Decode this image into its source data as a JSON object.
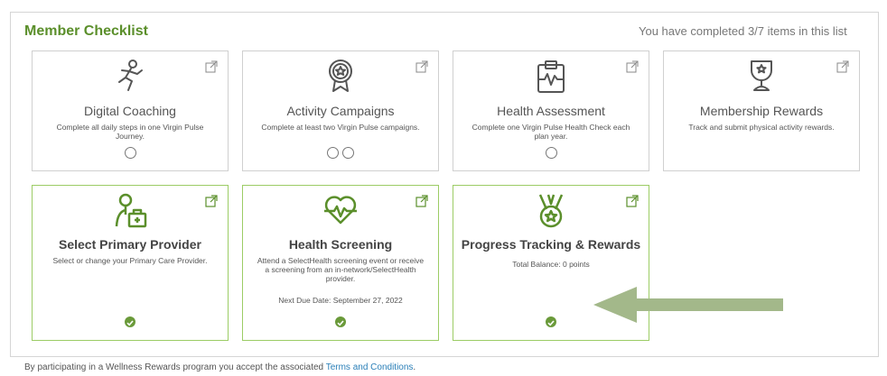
{
  "header": {
    "title": "Member Checklist",
    "status": "You have completed 3/7 items in this list"
  },
  "cards": [
    {
      "title": "Digital Coaching",
      "desc": "Complete all daily steps in one Virgin Pulse Journey.",
      "icon": "running-person-icon",
      "circles": 1
    },
    {
      "title": "Activity Campaigns",
      "desc": "Complete at least two Virgin Pulse campaigns.",
      "icon": "medal-icon",
      "circles": 2
    },
    {
      "title": "Health Assessment",
      "desc": "Complete one Virgin Pulse Health Check each plan year.",
      "icon": "clipboard-heartbeat-icon",
      "circles": 1
    },
    {
      "title": "Membership Rewards",
      "desc": "Track and submit physical activity rewards.",
      "icon": "trophy-icon",
      "circles": 0
    },
    {
      "title": "Select Primary Provider",
      "desc": "Select or change your Primary Care Provider.",
      "icon": "doctor-bag-icon",
      "completed": true
    },
    {
      "title": "Health Screening",
      "desc": "Attend a SelectHealth screening event or receive a screening from an in-network/SelectHealth provider.",
      "due": "Next Due Date: September 27, 2022",
      "icon": "heart-pulse-icon",
      "completed": true
    },
    {
      "title": "Progress Tracking & Rewards",
      "desc": "Total Balance: 0 points",
      "icon": "ribbon-medal-icon",
      "completed": true
    }
  ],
  "footer": {
    "text": "By participating in a Wellness Rewards program you accept the associated ",
    "link": "Terms and Conditions",
    "end": "."
  },
  "colors": {
    "accent": "#5b8f2b",
    "done_border": "#9ccc65",
    "arrow": "#a3b88a"
  }
}
